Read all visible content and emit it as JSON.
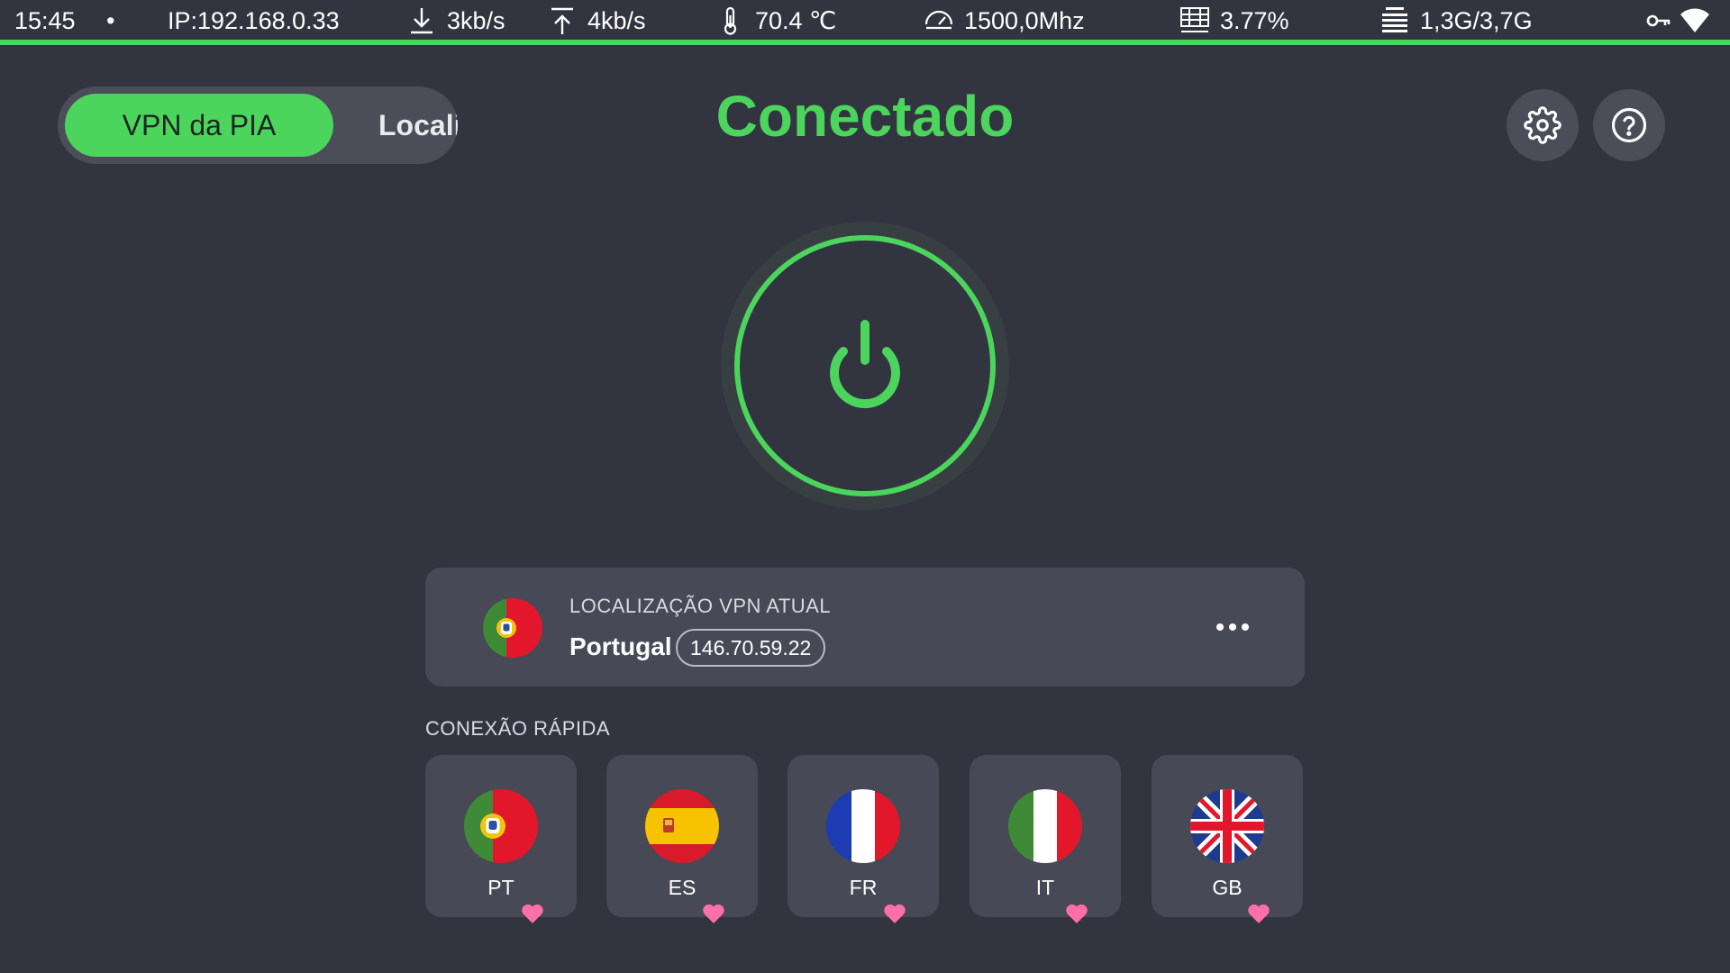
{
  "status_bar": {
    "time": "15:45",
    "dot": "•",
    "ip": "IP:192.168.0.33",
    "download": "3kb/s",
    "upload": "4kb/s",
    "cpu_temp": "70.4 ℃",
    "cpu_freq": "1500,0Mhz",
    "cpu_usage": "3.77%",
    "ram": "1,3G/3,7G",
    "icons": [
      "download-icon",
      "upload-icon",
      "thermometer-icon",
      "speedometer-icon",
      "cpu-chart-icon",
      "ram-icon",
      "key-icon",
      "wifi-icon"
    ]
  },
  "header": {
    "tabs": [
      {
        "label": "VPN da PIA",
        "active": true
      },
      {
        "label": "Localização",
        "active": false
      }
    ],
    "title": "Conectado",
    "icons": [
      "settings-icon",
      "help-icon"
    ]
  },
  "power": {
    "state": "connected",
    "icon": "power-icon"
  },
  "current_location": {
    "heading": "LOCALIZAÇÃO VPN ATUAL",
    "country": "Portugal",
    "ip": "146.70.59.22",
    "flag": "portugal-flag",
    "menu_icon": "more-horizontal-icon"
  },
  "quick_connect": {
    "title": "CONEXÃO RÁPIDA",
    "items": [
      {
        "code": "PT",
        "flag": "portugal-flag",
        "favorite": true
      },
      {
        "code": "ES",
        "flag": "spain-flag",
        "favorite": true
      },
      {
        "code": "FR",
        "flag": "france-flag",
        "favorite": true
      },
      {
        "code": "IT",
        "flag": "italy-flag",
        "favorite": true
      },
      {
        "code": "GB",
        "flag": "united-kingdom-flag",
        "favorite": true
      }
    ]
  },
  "colors": {
    "background": "#323440",
    "card": "#474957",
    "accent_green": "#4cd55c",
    "heart_pink": "#ff6fa8"
  }
}
